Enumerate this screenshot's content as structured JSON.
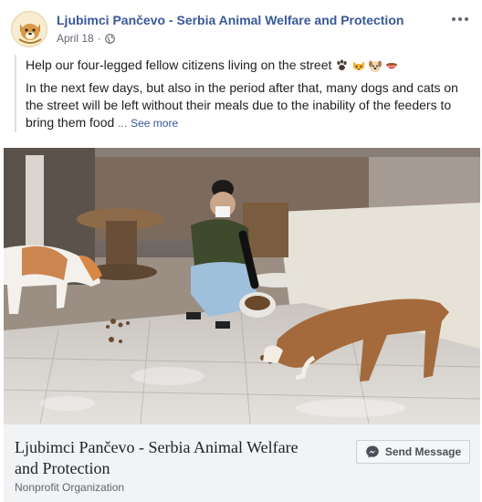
{
  "post": {
    "page_name": "Ljubimci Pančevo - Serbia Animal Welfare and Protection",
    "date": "April 18",
    "separator": "·",
    "icons": {
      "privacy": "globe-icon",
      "menu": "more-options-icon"
    }
  },
  "content": {
    "line1": "Help our four-legged fellow citizens living on the street",
    "emojis": [
      "paw-prints-icon",
      "cat-face-icon",
      "dog-face-icon",
      "food-bowl-icon"
    ],
    "paragraph": "In the next few days, but also in the period after that, many dogs and cats on the street will be left without their meals due to the inability of the feeders to bring them food",
    "ellipsis": "...",
    "see_more": "See more"
  },
  "attachment": {
    "title": "Ljubimci Pančevo - Serbia Animal Welfare and Protection",
    "subtitle": "Nonprofit Organization",
    "button_label": "Send Message"
  },
  "colors": {
    "link": "#385898",
    "footer_bg": "#f2f3f5",
    "text": "#1c1e21"
  }
}
